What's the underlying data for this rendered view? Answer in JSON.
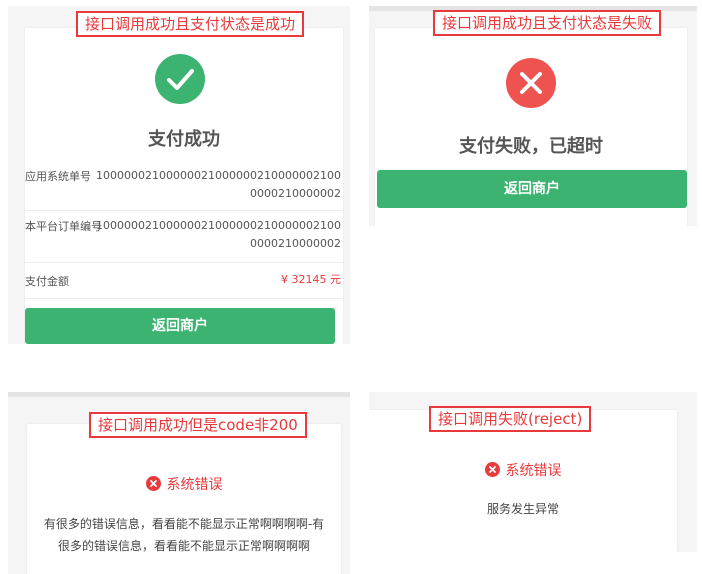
{
  "colors": {
    "success": "#3cb371",
    "danger": "#e8393b",
    "label_border": "#e8393b"
  },
  "panel_success": {
    "tag": "接口调用成功且支付状态是成功",
    "icon": "check-icon",
    "title": "支付成功",
    "rows": [
      {
        "label": "应用系统单号",
        "value_line1": "10000002100000021000000210000002100",
        "value_line2": "0000210000002"
      },
      {
        "label": "本平台订单编号",
        "value_line1": "10000002100000021000000210000002100",
        "value_line2": "0000210000002"
      }
    ],
    "amount_label": "支付金额",
    "amount_value": "¥ 32145 元",
    "button": "返回商户"
  },
  "panel_fail": {
    "tag": "接口调用成功且支付状态是失败",
    "icon": "close-icon",
    "title": "支付失败，已超时",
    "button": "返回商户"
  },
  "panel_code": {
    "tag": "接口调用成功但是code非200",
    "error_title": "系统错误",
    "message_line1": "有很多的错误信息，看看能不能显示正常啊啊啊啊-有",
    "message_line2": "很多的错误信息，看看能不能显示正常啊啊啊啊"
  },
  "panel_reject": {
    "tag": "接口调用失败(reject)",
    "error_title": "系统错误",
    "message": "服务发生异常"
  }
}
